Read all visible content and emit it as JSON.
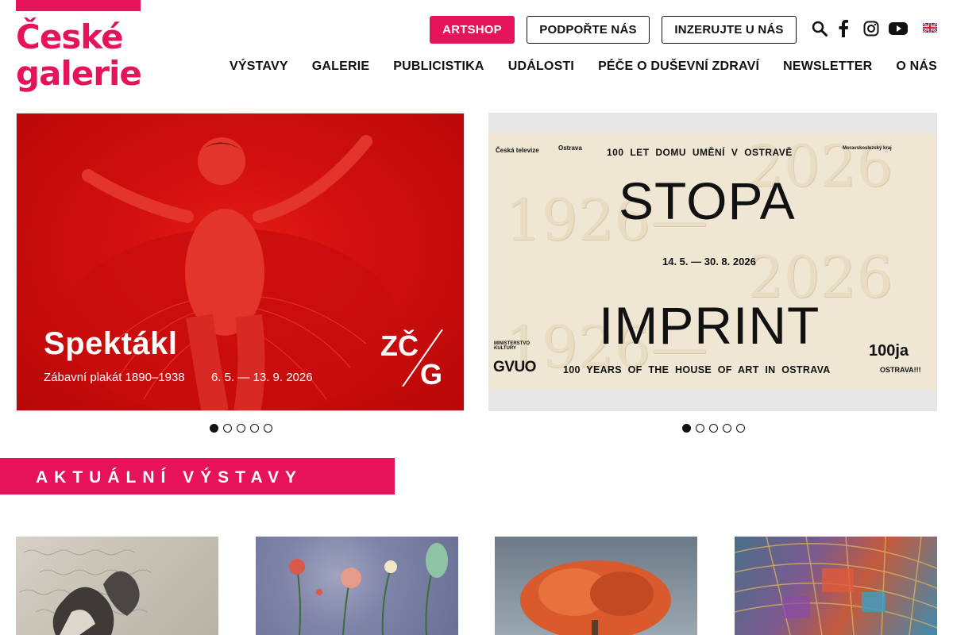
{
  "logo": {
    "line1": "České",
    "line2": "galerie"
  },
  "top_buttons": {
    "artshop": "ARTSHOP",
    "support": "PODPOŘTE NÁS",
    "advertise": "INZERUJTE U NÁS"
  },
  "icons": [
    "search-icon",
    "facebook-icon",
    "instagram-icon",
    "youtube-icon",
    "uk-flag-icon"
  ],
  "nav": [
    "VÝSTAVY",
    "GALERIE",
    "PUBLICISTIKA",
    "UDÁLOSTI",
    "PÉČE O DUŠEVNÍ ZDRAVÍ",
    "NEWSLETTER",
    "O NÁS"
  ],
  "banner_left": {
    "title": "Spektákl",
    "subtitle": "Zábavní plakát 1890–1938",
    "dates": "6. 5. — 13. 9. 2026",
    "logo_top": "ZČ",
    "logo_bottom": "G"
  },
  "banner_right": {
    "sponsor_tv": "Česká televize",
    "sponsor_ostrava": "Ostrava",
    "headline": "100 LET DOMU UMĚNÍ V OSTRAVĚ",
    "title1": "STOPA",
    "dates": "14. 5. — 30. 8. 2026",
    "title2": "IMPRINT",
    "ministry": "MINISTERSTVO KULTURY",
    "gallery": "GVUO",
    "subtitle_en": "100 YEARS OF THE HOUSE OF ART IN OSTRAVA",
    "brand": "100ja",
    "brand_sub": "OSTRAVA!!!",
    "kraj": "Moravskoslezský kraj",
    "year_ghost1": "1926—",
    "year_ghost2": "2026"
  },
  "slider_left": {
    "count": 5,
    "active": 1
  },
  "slider_right": {
    "count": 5,
    "active": 1
  },
  "section": {
    "title": "AKTUÁLNÍ VÝSTAVY"
  },
  "colors": {
    "accent": "#e6135b",
    "text": "#111111"
  }
}
